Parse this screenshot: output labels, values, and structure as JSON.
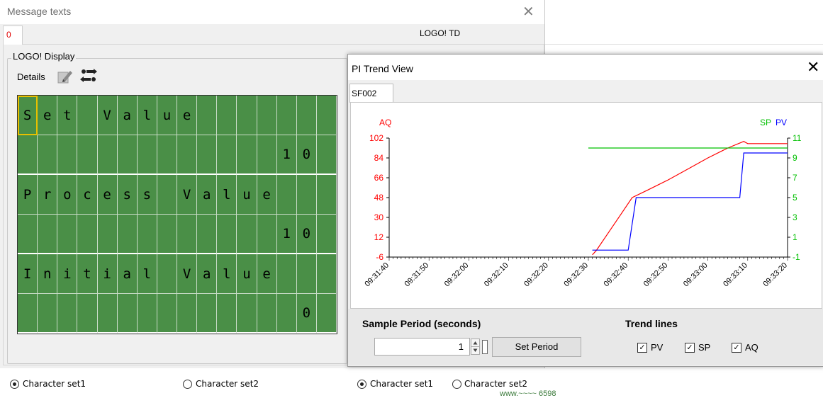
{
  "message_window": {
    "title": "Message texts",
    "close_glyph": "✕",
    "tab_label": "0",
    "header_label": "LOGO! TD",
    "group_title": "LOGO! Display",
    "details_label": "Details",
    "icons": [
      "edit-icon",
      "configure-icon"
    ]
  },
  "lcd": {
    "rows": [
      "Set Value       ",
      "             10 ",
      "Process Value   ",
      "             10 ",
      "Initial Value   ",
      "              0 "
    ],
    "background": "#4a8f47",
    "cursor_cell": "0,0"
  },
  "charset_left": {
    "option1": "Character set1",
    "option2": "Character set2",
    "selected": "Character set1"
  },
  "charset_right": {
    "option1": "Character set1",
    "option2": "Character set2",
    "selected": "Character set1"
  },
  "pi_window": {
    "title": "PI Trend View",
    "close_glyph": "✕",
    "tab_label": "SF002",
    "sample_period_label": "Sample Period (seconds)",
    "sample_period_value": "1",
    "set_period_button": "Set Period",
    "trend_lines_label": "Trend lines",
    "checkboxes": [
      {
        "label": "PV",
        "checked": true
      },
      {
        "label": "SP",
        "checked": true
      },
      {
        "label": "AQ",
        "checked": true
      }
    ]
  },
  "chart_data": {
    "type": "line",
    "left_axis": {
      "label": "AQ",
      "color": "#ff0000",
      "ticks": [
        "102",
        "84",
        "66",
        "48",
        "30",
        "12",
        "-6"
      ],
      "range": [
        -6,
        102
      ]
    },
    "right_axis": {
      "labels": [
        {
          "text": "SP",
          "color": "#00c000"
        },
        {
          "text": "PV",
          "color": "#0000ff"
        }
      ],
      "ticks": [
        "11",
        "9",
        "7",
        "5",
        "3",
        "1",
        "-1"
      ],
      "range": [
        -1,
        11
      ]
    },
    "x_ticks": [
      "09:31:40",
      "09:31:50",
      "09:32:00",
      "09:32:10",
      "09:32:20",
      "09:32:30",
      "09:32:40",
      "09:32:50",
      "09:33:00",
      "09:33:10",
      "09:33:20"
    ],
    "series": [
      {
        "name": "AQ",
        "color": "#ff0000",
        "axis": "left",
        "points": [
          [
            "09:32:31",
            -4
          ],
          [
            "09:32:32",
            0
          ],
          [
            "09:32:35",
            16
          ],
          [
            "09:32:38",
            32
          ],
          [
            "09:32:41",
            48
          ],
          [
            "09:32:45",
            55
          ],
          [
            "09:32:50",
            64
          ],
          [
            "09:32:55",
            74
          ],
          [
            "09:33:00",
            84
          ],
          [
            "09:33:05",
            93
          ],
          [
            "09:33:09",
            99
          ],
          [
            "09:33:10",
            97
          ],
          [
            "09:33:20",
            97
          ]
        ]
      },
      {
        "name": "PV",
        "color": "#0000ff",
        "axis": "right",
        "points": [
          [
            "09:32:31",
            -0.3
          ],
          [
            "09:32:40",
            -0.3
          ],
          [
            "09:32:42",
            5
          ],
          [
            "09:33:08",
            5
          ],
          [
            "09:33:09",
            9.5
          ],
          [
            "09:33:20",
            9.5
          ]
        ]
      },
      {
        "name": "SP",
        "color": "#00c000",
        "axis": "right",
        "points": [
          [
            "09:32:30",
            10
          ],
          [
            "09:33:20",
            10
          ]
        ]
      }
    ]
  },
  "background": {
    "partial_text": "www.~~~~ 6598"
  }
}
